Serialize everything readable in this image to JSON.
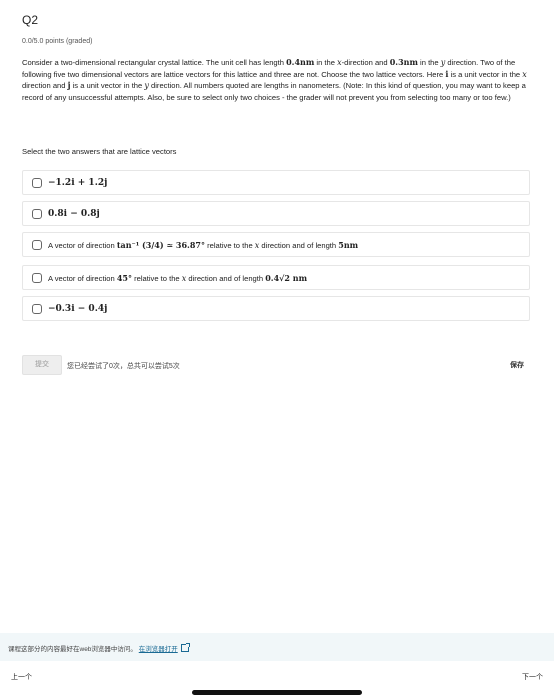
{
  "question": {
    "title": "Q2",
    "points": "0.0/5.0 points (graded)",
    "prompt": {
      "p1": "Consider a two-dimensional rectangular crystal lattice. The unit cell has length ",
      "len_x": "0.4nm",
      "p2": " in the ",
      "var_x": "x",
      "p3": "-direction and ",
      "len_y": "0.3nm",
      "p4": " in the ",
      "var_y": "y",
      "p5": " direction. Two of the following five two dimensional vectors are lattice vectors for this lattice and three are not. Choose the two lattice vectors. Here ",
      "unit_i": "i",
      "p6": " is a unit vector in the ",
      "var_x2": "x",
      "p7": " direction and ",
      "unit_j": "j",
      "p8": " is a unit vector in the ",
      "var_y2": "y",
      "p9": " direction. All numbers quoted are lengths in nanometers. (Note: In this kind of question, you may want to keep a record of any unsuccessful attempts. Also, be sure to select only two choices - the grader will not prevent you from selecting too many or too few.)"
    },
    "select_label": "Select the two answers that are lattice vectors"
  },
  "options": [
    {
      "math": "−1.2i + 1.2j"
    },
    {
      "math": "0.8i − 0.8j"
    },
    {
      "a": "A vector of direction ",
      "b": "tan⁻¹ (3/4) ≃ 36.87°",
      "c": " relative to the ",
      "d": "x",
      "e": " direction and of length ",
      "f": "5nm"
    },
    {
      "a": "A vector of direction ",
      "b": "45°",
      "c": " relative to the ",
      "d": "x",
      "e": " direction and of length ",
      "f": "0.4√2 nm"
    },
    {
      "math": "−0.3i − 0.4j"
    }
  ],
  "actions": {
    "submit_label": "提交",
    "attempts_text": "您已经尝试了0次，总共可以尝试5次",
    "save_label": "保存"
  },
  "footer": {
    "text": "课程这部分的内容最好在web浏览器中访问。",
    "link": "在浏览器打开",
    "ext_icon": "external-link-icon"
  },
  "nav": {
    "prev": "上一个",
    "next": "下一个"
  }
}
